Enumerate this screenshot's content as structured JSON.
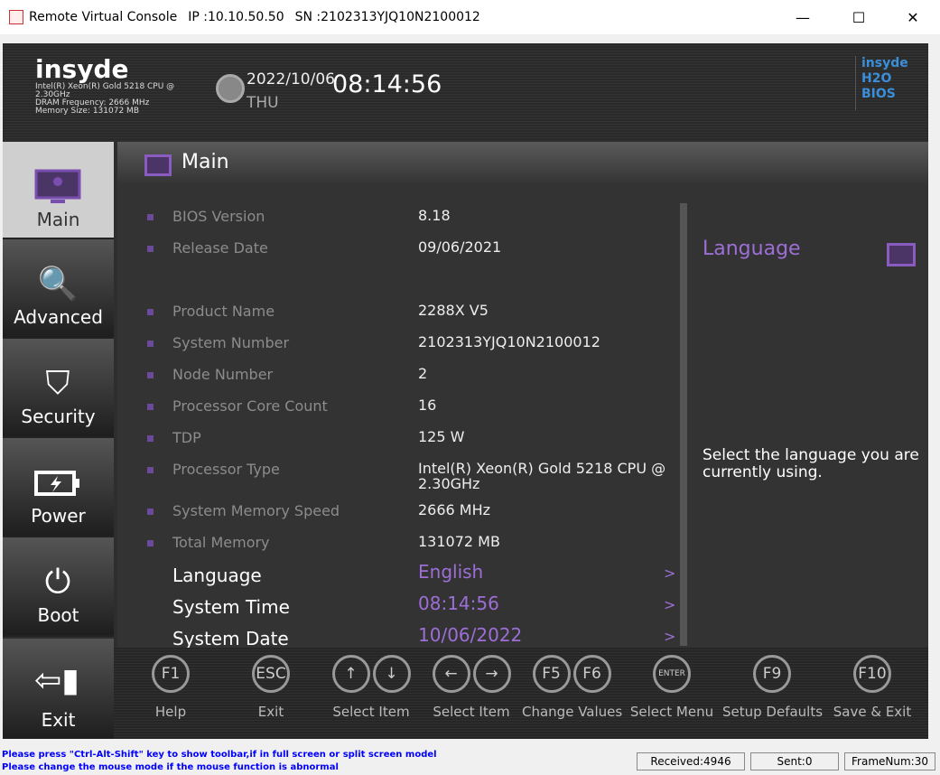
{
  "window": {
    "title": "Remote Virtual Console",
    "ip": "IP :10.10.50.50",
    "sn": "SN :2102313YJQ10N2100012"
  },
  "header": {
    "logo": "insyde",
    "cpu": "Intel(R) Xeon(R) Gold 5218 CPU @ 2.30GHz",
    "dram": "DRAM Frequency: 2666 MHz",
    "memory": "Memory Size: 131072 MB",
    "date": "2022/10/06",
    "day": "THU",
    "time": "08:14:56",
    "brand": "insyde H2O BIOS"
  },
  "sidebar": {
    "items": [
      {
        "label": "Main",
        "icon": "monitor-icon"
      },
      {
        "label": "Advanced",
        "icon": "search-document-icon"
      },
      {
        "label": "Security",
        "icon": "shield-icon"
      },
      {
        "label": "Power",
        "icon": "battery-icon"
      },
      {
        "label": "Boot",
        "icon": "power-icon"
      },
      {
        "label": "Exit",
        "icon": "exit-door-icon"
      }
    ]
  },
  "main": {
    "title": "Main",
    "info": [
      {
        "k": "BIOS Version",
        "v": "8.18"
      },
      {
        "k": "Release Date",
        "v": "09/06/2021"
      },
      {
        "k": "Product Name",
        "v": "2288X V5"
      },
      {
        "k": "System Number",
        "v": "2102313YJQ10N2100012"
      },
      {
        "k": "Node Number",
        "v": "2"
      },
      {
        "k": "Processor Core Count",
        "v": "16"
      },
      {
        "k": "TDP",
        "v": "125 W"
      },
      {
        "k": "Processor Type",
        "v": "Intel(R) Xeon(R) Gold 5218 CPU @ 2.30GHz"
      },
      {
        "k": "System Memory Speed",
        "v": "2666 MHz"
      },
      {
        "k": "Total Memory",
        "v": "131072 MB"
      }
    ],
    "settings": [
      {
        "k": "Language",
        "v": "English",
        "arrow": ">"
      },
      {
        "k": "System Time",
        "v": "08:14:56",
        "arrow": ">"
      },
      {
        "k": "System Date",
        "v": "10/06/2022",
        "arrow": ">"
      }
    ]
  },
  "help": {
    "title": "Language",
    "text": "Select the language you are currently using."
  },
  "footer": [
    {
      "keys": [
        "F1"
      ],
      "label": "Help"
    },
    {
      "keys": [
        "ESC"
      ],
      "label": "Exit"
    },
    {
      "keys": [
        "↑",
        "↓"
      ],
      "label": "Select Item"
    },
    {
      "keys": [
        "←",
        "→"
      ],
      "label": "Select Item"
    },
    {
      "keys": [
        "F5",
        "F6"
      ],
      "label": "Change Values"
    },
    {
      "keys": [
        "ENTER"
      ],
      "label": "Select Menu"
    },
    {
      "keys": [
        "F9"
      ],
      "label": "Setup Defaults"
    },
    {
      "keys": [
        "F10"
      ],
      "label": "Save & Exit"
    }
  ],
  "status": {
    "msg1": "Please press \"Ctrl-Alt-Shift\" key to show toolbar,if in full screen or split screen model",
    "msg2": "Please change the mouse mode if the mouse function is abnormal",
    "received": "Received:4946",
    "sent": "Sent:0",
    "frame": "FrameNum:30"
  },
  "colors": {
    "accent": "#9d6fd6",
    "background": "#2e2e2e"
  }
}
